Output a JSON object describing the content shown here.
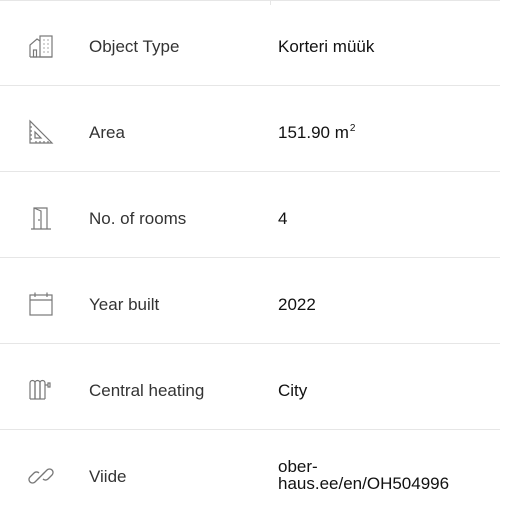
{
  "details": [
    {
      "label": "Object Type",
      "value": "Korteri müük",
      "icon": "building-icon"
    },
    {
      "label": "Area",
      "value": "151.90 m",
      "unit_sup": "2",
      "icon": "set-square-icon"
    },
    {
      "label": "No. of rooms",
      "value": "4",
      "icon": "door-icon"
    },
    {
      "label": "Year built",
      "value": "2022",
      "icon": "calendar-icon"
    },
    {
      "label": "Central heating",
      "value": "City",
      "icon": "radiator-icon"
    },
    {
      "label": "Viide",
      "value_line1": "ober-",
      "value_line2": "haus.ee/en/OH504996",
      "icon": "link-icon"
    }
  ]
}
